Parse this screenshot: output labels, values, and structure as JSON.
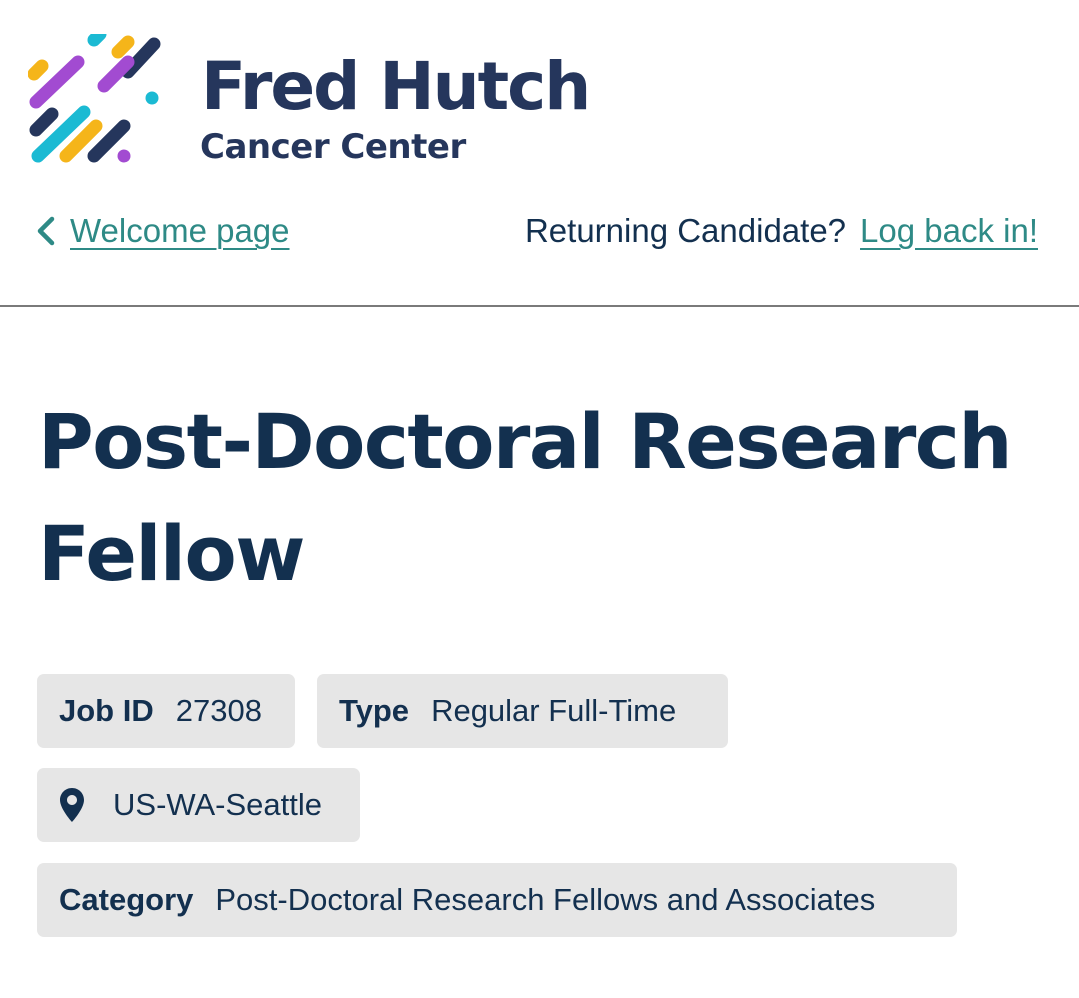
{
  "brand": {
    "name": "Fred Hutch",
    "tagline": "Cancer Center",
    "colors": {
      "navy": "#25365c",
      "purple": "#a24bd1",
      "cyan": "#1bbad3",
      "gold": "#f5b51a"
    }
  },
  "nav": {
    "back_label": "Welcome page",
    "back_icon": "chevron-left-icon",
    "returning_prompt": "Returning Candidate?",
    "login_label": "Log back in!"
  },
  "job": {
    "title": "Post-Doctoral Research Fellow",
    "id_label": "Job ID",
    "id_value": "27308",
    "type_label": "Type",
    "type_value": "Regular Full-Time",
    "location_icon": "map-pin-icon",
    "location_value": "US-WA-Seattle",
    "category_label": "Category",
    "category_value": "Post-Doctoral Research Fellows and Associates"
  },
  "colors": {
    "link": "#2e8a86",
    "text": "#13304f",
    "tag_background": "#e6e6e6",
    "divider": "#7a7a7a"
  }
}
